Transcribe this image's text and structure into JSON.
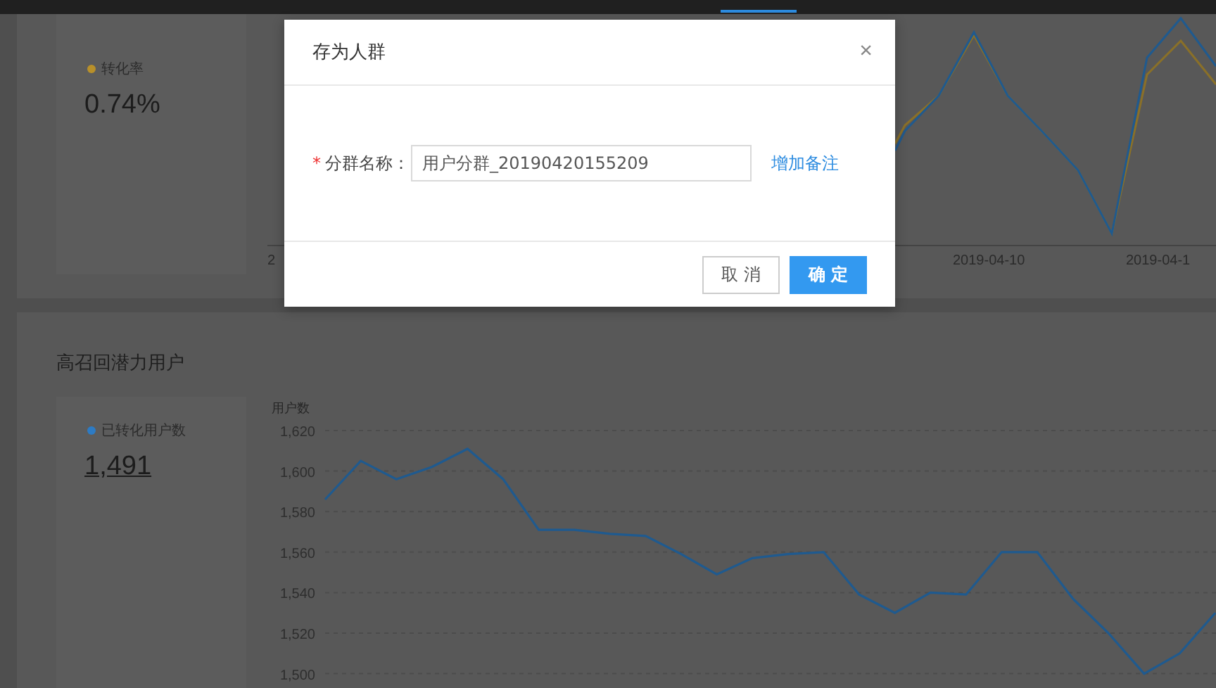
{
  "top_card": {
    "stat": {
      "label": "转化率",
      "color": "#b8902a",
      "value": "0.74%"
    },
    "chart": {
      "x_labels": [
        "2",
        "2019-04-10",
        "2019-04-1"
      ]
    }
  },
  "bottom_card": {
    "title": "高召回潜力用户",
    "stat": {
      "label": "已转化用户数",
      "color": "#2d7bc4",
      "value": "1,491"
    },
    "chart_data": {
      "type": "line",
      "grid": true,
      "ylabel": "用户数",
      "ylim": [
        1500,
        1620
      ],
      "yticks": [
        {
          "value": 1620,
          "label": "1,620"
        },
        {
          "value": 1600,
          "label": "1,600"
        },
        {
          "value": 1580,
          "label": "1,580"
        },
        {
          "value": 1560,
          "label": "1,560"
        },
        {
          "value": 1540,
          "label": "1,540"
        },
        {
          "value": 1520,
          "label": "1,520"
        },
        {
          "value": 1500,
          "label": "1,500"
        }
      ],
      "series": [
        {
          "color": "#1f5a8f",
          "values": [
            1586,
            1605,
            1596,
            1602,
            1611,
            1596,
            1571,
            1571,
            1569,
            1568,
            1559,
            1549,
            1557,
            1559,
            1560,
            1539,
            1530,
            1540,
            1539,
            1560,
            1560,
            1537,
            1520,
            1500,
            1510,
            1530
          ]
        }
      ]
    }
  },
  "dialog": {
    "title": "存为人群",
    "close": "×",
    "field": {
      "required": true,
      "required_mark": "*",
      "label": "分群名称：",
      "value": "用户分群_20190420155209"
    },
    "link": "增加备注",
    "buttons": [
      {
        "label": "取 消",
        "kind": "default"
      },
      {
        "label": "确 定",
        "kind": "primary"
      }
    ]
  }
}
